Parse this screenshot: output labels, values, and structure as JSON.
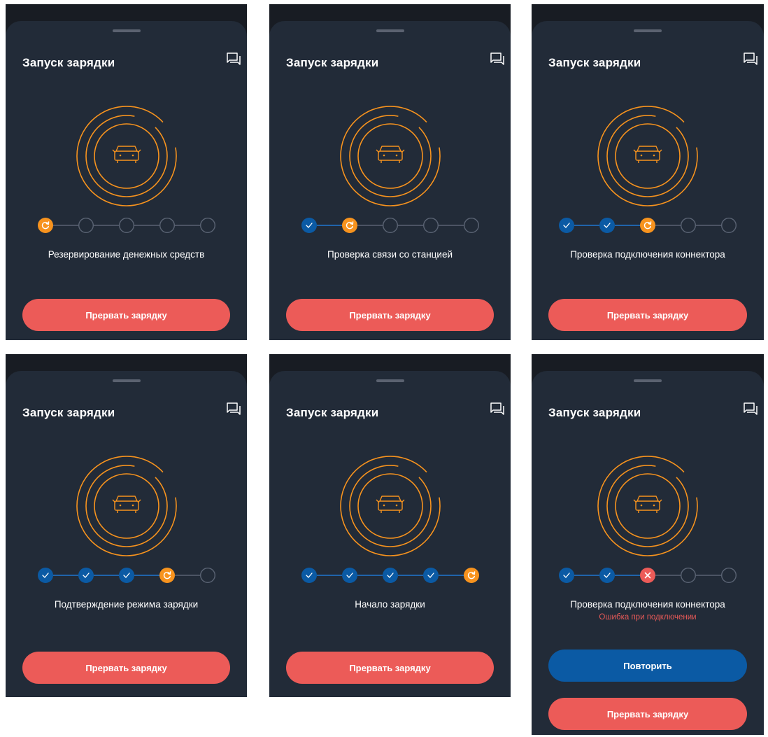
{
  "screens": [
    {
      "title": "Запуск зарядки",
      "step_label": "Резервирование денежных средств",
      "error": "",
      "steps": [
        "active",
        "pending",
        "pending",
        "pending",
        "pending"
      ],
      "retry_label": "",
      "abort_label": "Прервать зарядку"
    },
    {
      "title": "Запуск зарядки",
      "step_label": "Проверка связи со станцией",
      "error": "",
      "steps": [
        "done",
        "active",
        "pending",
        "pending",
        "pending"
      ],
      "retry_label": "",
      "abort_label": "Прервать зарядку"
    },
    {
      "title": "Запуск зарядки",
      "step_label": "Проверка подключения коннектора",
      "error": "",
      "steps": [
        "done",
        "done",
        "active",
        "pending",
        "pending"
      ],
      "retry_label": "",
      "abort_label": "Прервать зарядку"
    },
    {
      "title": "Запуск зарядки",
      "step_label": "Подтверждение режима зарядки",
      "error": "",
      "steps": [
        "done",
        "done",
        "done",
        "active",
        "pending"
      ],
      "retry_label": "",
      "abort_label": "Прервать зарядку"
    },
    {
      "title": "Запуск зарядки",
      "step_label": "Начало зарядки",
      "error": "",
      "steps": [
        "done",
        "done",
        "done",
        "done",
        "active"
      ],
      "retry_label": "",
      "abort_label": "Прервать зарядку"
    },
    {
      "title": "Запуск зарядки",
      "step_label": "Проверка подключения коннектора",
      "error": "Ошибка при подключении",
      "steps": [
        "done",
        "done",
        "error",
        "pending",
        "pending"
      ],
      "retry_label": "Повторить",
      "abort_label": "Прервать зарядку"
    }
  ],
  "icons": {
    "chat": "chat-bubbles-icon",
    "car": "car-icon",
    "step_done": "checkmark-icon",
    "step_active": "refresh-icon",
    "step_error": "close-icon"
  },
  "colors": {
    "sheet_bg": "#222b38",
    "accent_orange": "#f7931e",
    "done_blue": "#0b5aa4",
    "connector_blue": "#1f78d1",
    "pending_ring": "#5a6373",
    "abort_red": "#ec5b58",
    "error_text": "#e95a58"
  }
}
